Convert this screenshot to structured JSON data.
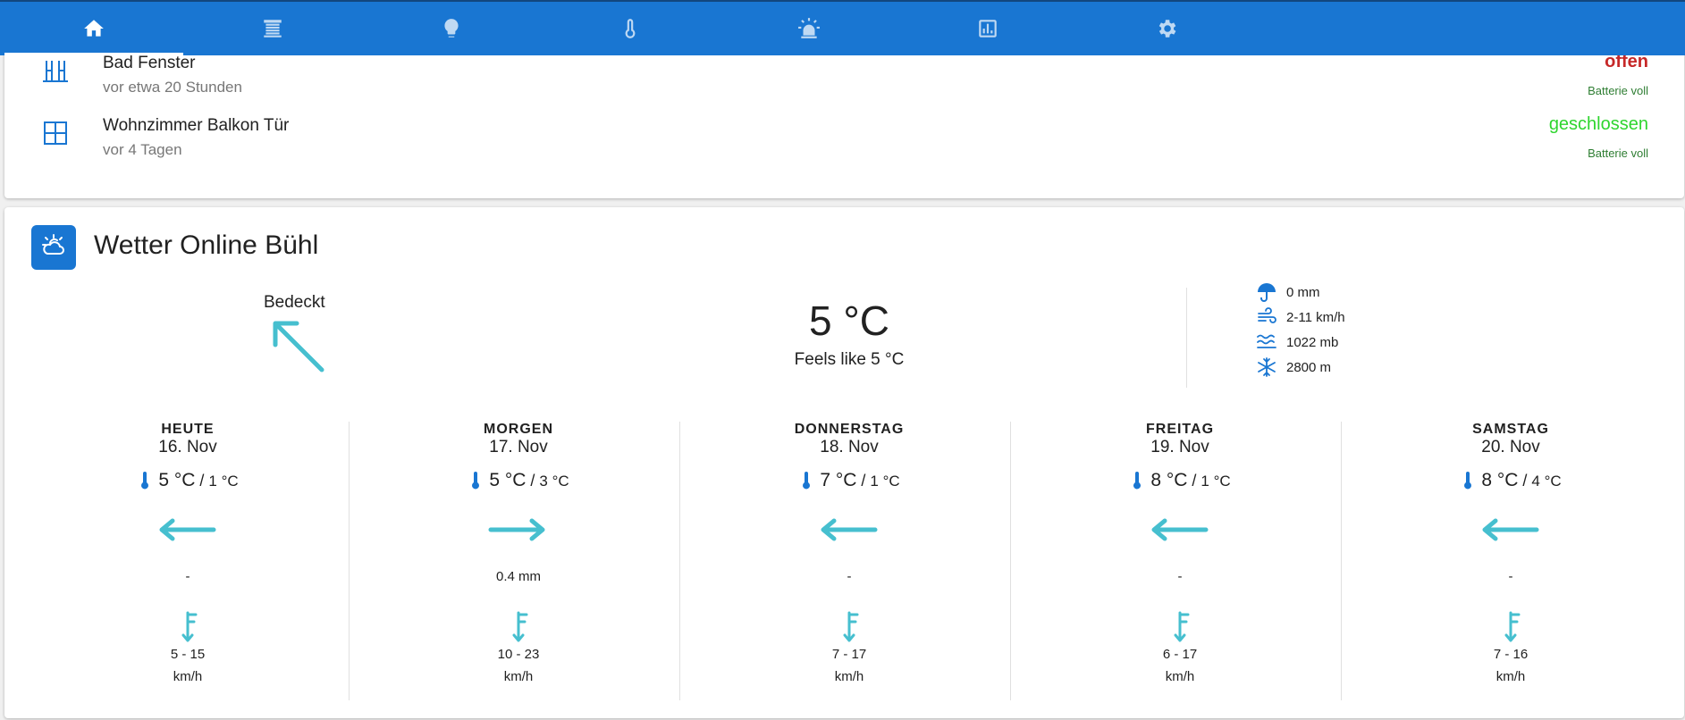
{
  "colors": {
    "primary": "#1976d2",
    "accent_arrow": "#46bfcf",
    "state_open": "#c62828",
    "state_closed": "#2ed52e",
    "battery_text": "#2e7d32"
  },
  "nav": {
    "tabs": [
      {
        "icon": "home-icon",
        "active": true
      },
      {
        "icon": "blinds-icon",
        "active": false
      },
      {
        "icon": "lightbulb-icon",
        "active": false
      },
      {
        "icon": "thermometer-icon",
        "active": false
      },
      {
        "icon": "alarm-light-icon",
        "active": false
      },
      {
        "icon": "chart-icon",
        "active": false
      },
      {
        "icon": "gear-icon",
        "active": false
      }
    ]
  },
  "sensors": [
    {
      "name": "Bad Fenster",
      "last_changed": "vor etwa 20 Stunden",
      "state": "offen",
      "battery": "Batterie voll",
      "icon": "window-open-icon"
    },
    {
      "name": "Wohnzimmer Balkon Tür",
      "last_changed": "vor 4 Tagen",
      "state": "geschlossen",
      "battery": "Batterie voll",
      "icon": "window-closed-icon"
    }
  ],
  "weather": {
    "title": "Wetter Online Bühl",
    "condition": "Bedeckt",
    "temperature": "5 °C",
    "feels_like": "Feels like 5 °C",
    "attributes": [
      {
        "icon": "umbrella-icon",
        "value": "0 mm"
      },
      {
        "icon": "wind-icon",
        "value": "2-11 km/h"
      },
      {
        "icon": "pressure-icon",
        "value": "1022 mb"
      },
      {
        "icon": "visibility-icon",
        "value": "2800 m"
      }
    ],
    "forecast": [
      {
        "day": "HEUTE",
        "date": "16. Nov",
        "high": "5 °C",
        "low": "1 °C",
        "wind_dir": "left",
        "precip": "-",
        "wind": "5 - 15",
        "wind_unit": "km/h"
      },
      {
        "day": "MORGEN",
        "date": "17. Nov",
        "high": "5 °C",
        "low": "3 °C",
        "wind_dir": "right",
        "precip": "0.4 mm",
        "wind": "10 - 23",
        "wind_unit": "km/h"
      },
      {
        "day": "DONNERSTAG",
        "date": "18. Nov",
        "high": "7 °C",
        "low": "1 °C",
        "wind_dir": "left",
        "precip": "-",
        "wind": "7 - 17",
        "wind_unit": "km/h"
      },
      {
        "day": "FREITAG",
        "date": "19. Nov",
        "high": "8 °C",
        "low": "1 °C",
        "wind_dir": "left",
        "precip": "-",
        "wind": "6 - 17",
        "wind_unit": "km/h"
      },
      {
        "day": "SAMSTAG",
        "date": "20. Nov",
        "high": "8 °C",
        "low": "4 °C",
        "wind_dir": "left",
        "precip": "-",
        "wind": "7 - 16",
        "wind_unit": "km/h"
      }
    ]
  }
}
